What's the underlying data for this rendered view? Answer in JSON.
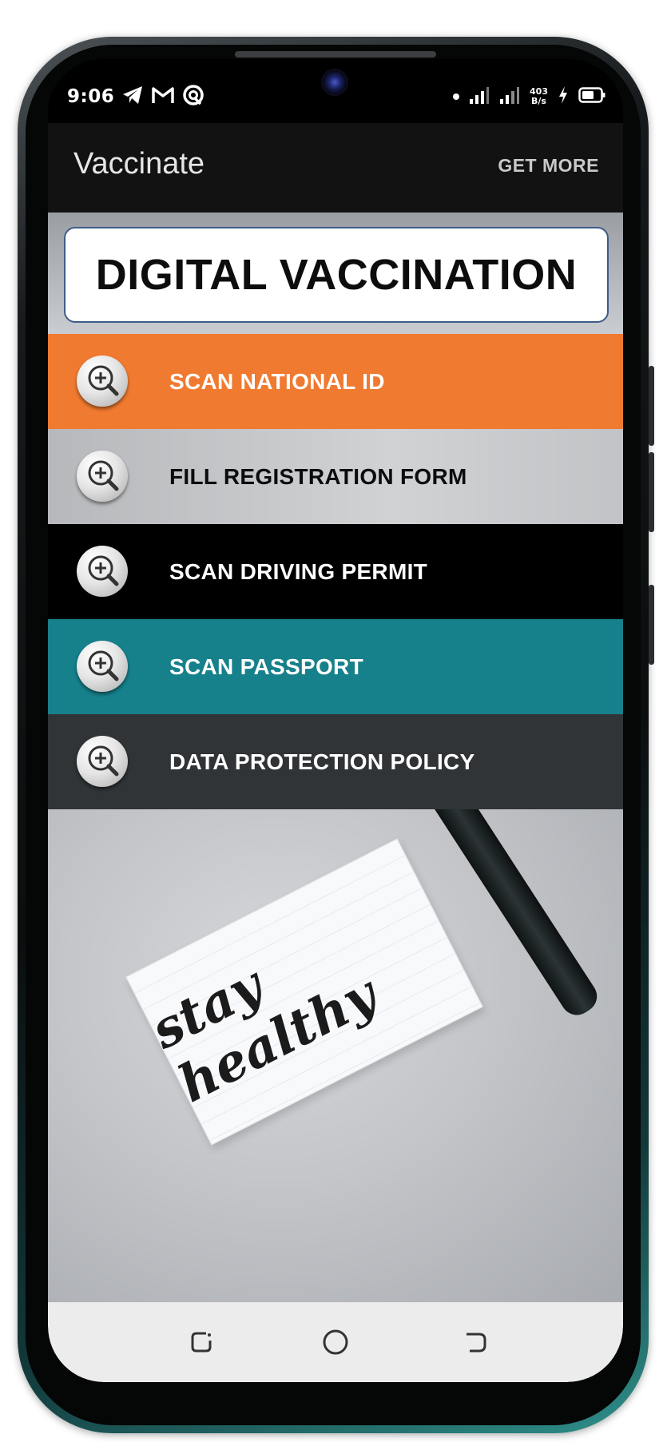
{
  "status_bar": {
    "time": "9:06",
    "left_icons": [
      "telegram-icon",
      "gmail-icon",
      "vpn-icon"
    ],
    "net_speed_value": "403",
    "net_speed_unit": "B/s",
    "right_icons": [
      "notification-dot-icon",
      "signal-icon",
      "signal-icon",
      "charging-icon",
      "battery-icon"
    ]
  },
  "app_bar": {
    "title": "Vaccinate",
    "action_label": "GET MORE"
  },
  "banner": {
    "title": "DIGITAL VACCINATION"
  },
  "menu": {
    "items": [
      {
        "label": "SCAN NATIONAL ID",
        "color": "#f07a30",
        "icon": "zoom-in-icon"
      },
      {
        "label": "FILL REGISTRATION FORM",
        "color": "#c8cacc",
        "icon": "zoom-in-icon"
      },
      {
        "label": "SCAN DRIVING PERMIT",
        "color": "#000000",
        "icon": "zoom-in-icon"
      },
      {
        "label": "SCAN PASSPORT",
        "color": "#16808b",
        "icon": "zoom-in-icon"
      },
      {
        "label": "DATA PROTECTION POLICY",
        "color": "#303436",
        "icon": "zoom-in-icon"
      }
    ]
  },
  "photo": {
    "note_text": "stay healthy"
  },
  "nav_bar": {
    "buttons": [
      "recents-icon",
      "home-icon",
      "back-icon"
    ]
  }
}
